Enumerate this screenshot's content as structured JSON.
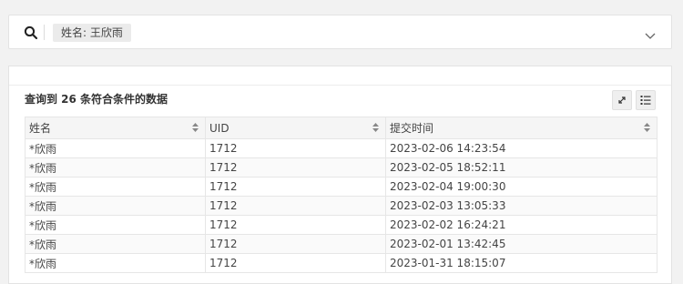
{
  "search": {
    "filter_tag": "姓名: 王欣雨"
  },
  "results": {
    "count_text": "查询到 26 条符合条件的数据"
  },
  "table": {
    "columns": [
      {
        "label": "姓名"
      },
      {
        "label": "UID"
      },
      {
        "label": "提交时间"
      }
    ],
    "rows": [
      {
        "name": "*欣雨",
        "uid": "1712",
        "time": "2023-02-06 14:23:54"
      },
      {
        "name": "*欣雨",
        "uid": "1712",
        "time": "2023-02-05 18:52:11"
      },
      {
        "name": "*欣雨",
        "uid": "1712",
        "time": "2023-02-04 19:00:30"
      },
      {
        "name": "*欣雨",
        "uid": "1712",
        "time": "2023-02-03 13:05:33"
      },
      {
        "name": "*欣雨",
        "uid": "1712",
        "time": "2023-02-02 16:24:21"
      },
      {
        "name": "*欣雨",
        "uid": "1712",
        "time": "2023-02-01 13:42:45"
      },
      {
        "name": "*欣雨",
        "uid": "1712",
        "time": "2023-01-31 18:15:07"
      }
    ]
  },
  "icons": {
    "search": "search-icon",
    "expand": "chevron-down-icon",
    "fullscreen": "expand-arrows-icon",
    "columns": "list-settings-icon",
    "sort": "sort-icon"
  },
  "colors": {
    "page_background": "#f2f2f2",
    "panel_background": "#ffffff",
    "tag_background": "#ebebeb",
    "header_background": "#f5f5f5",
    "border": "#e6e6e6"
  }
}
